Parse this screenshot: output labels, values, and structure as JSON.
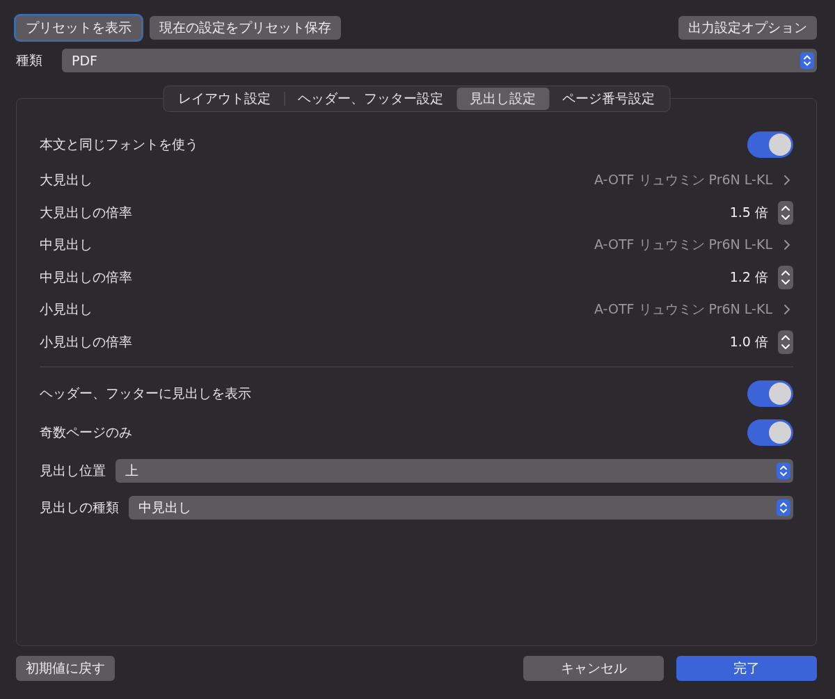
{
  "toolbar": {
    "buttons": [
      {
        "label": "プリセットを表示",
        "focused": true
      },
      {
        "label": "現在の設定をプリセット保存",
        "focused": false
      }
    ],
    "options_button": {
      "label": "出力設定オプション"
    }
  },
  "type_field": {
    "label": "種類",
    "value": "PDF"
  },
  "tabs": [
    {
      "label": "レイアウト設定",
      "selected": false
    },
    {
      "label": "ヘッダー、フッター設定",
      "selected": false
    },
    {
      "label": "見出し設定",
      "selected": true
    },
    {
      "label": "ページ番号設定",
      "selected": false
    }
  ],
  "sections": [
    {
      "rows": [
        {
          "kind": "toggle",
          "label": "本文と同じフォントを使う",
          "on": true
        },
        {
          "kind": "font",
          "label": "大見出し",
          "value": "A-OTF リュウミン Pr6N L-KL"
        },
        {
          "kind": "stepper",
          "label": "大見出しの倍率",
          "value": "1.5 倍"
        },
        {
          "kind": "font",
          "label": "中見出し",
          "value": "A-OTF リュウミン Pr6N L-KL"
        },
        {
          "kind": "stepper",
          "label": "中見出しの倍率",
          "value": "1.2 倍"
        },
        {
          "kind": "font",
          "label": "小見出し",
          "value": "A-OTF リュウミン Pr6N L-KL"
        },
        {
          "kind": "stepper",
          "label": "小見出しの倍率",
          "value": "1.0 倍"
        }
      ]
    },
    {
      "rows": [
        {
          "kind": "toggle",
          "label": "ヘッダー、フッターに見出しを表示",
          "on": true
        },
        {
          "kind": "toggle",
          "label": "奇数ページのみ",
          "on": true
        },
        {
          "kind": "select",
          "label": "見出し位置",
          "value": "上"
        },
        {
          "kind": "select",
          "label": "見出しの種類",
          "value": "中見出し"
        }
      ]
    }
  ],
  "footer": {
    "reset_button": "初期値に戻す",
    "buttons": [
      {
        "label": "キャンセル",
        "kind": "secondary"
      },
      {
        "label": "完了",
        "kind": "primary"
      }
    ]
  }
}
